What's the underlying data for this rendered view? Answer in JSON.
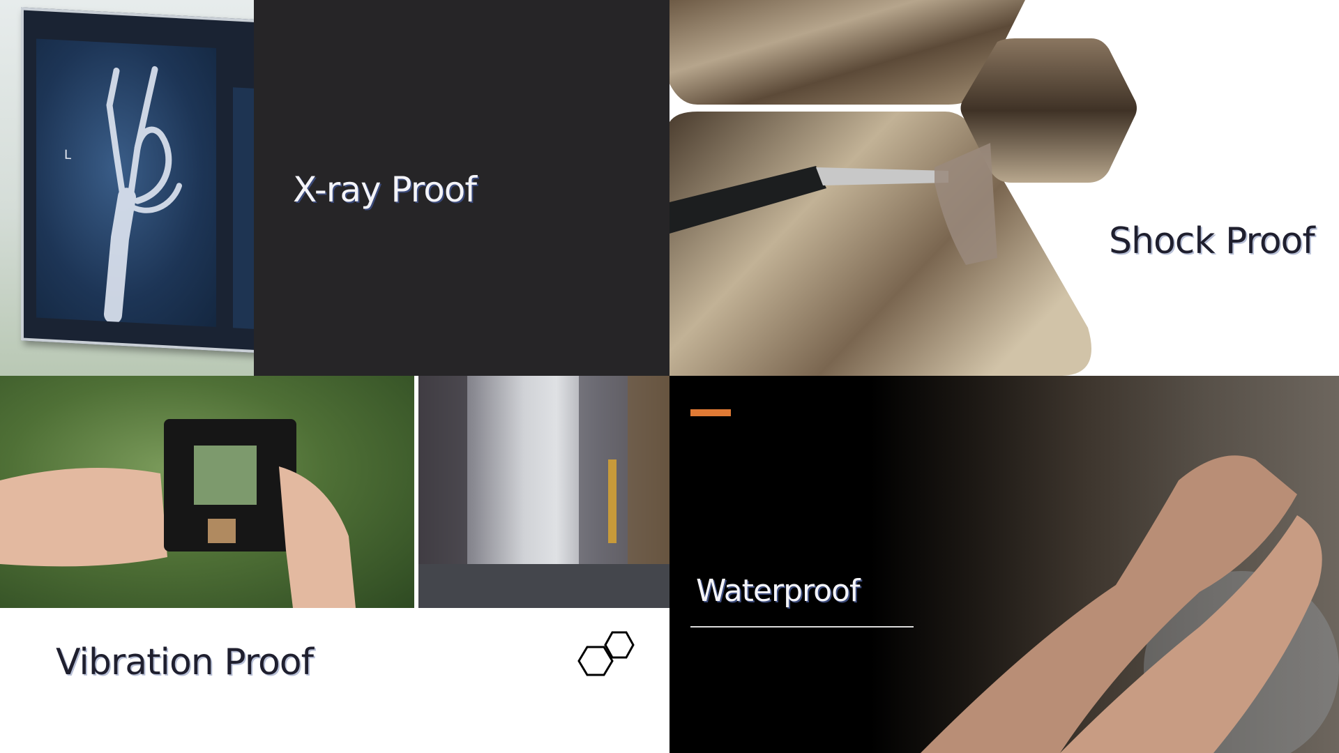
{
  "panels": {
    "xray": {
      "title": "X-ray Proof"
    },
    "shock": {
      "title": "Shock Proof"
    },
    "vibration": {
      "title": "Vibration Proof"
    },
    "water": {
      "title": "Waterproof"
    }
  },
  "colors": {
    "dark_panel": "#262527",
    "accent_orange": "#e07a35",
    "black": "#000000",
    "white": "#ffffff"
  },
  "icons": {
    "logo": "hexagons-icon"
  }
}
